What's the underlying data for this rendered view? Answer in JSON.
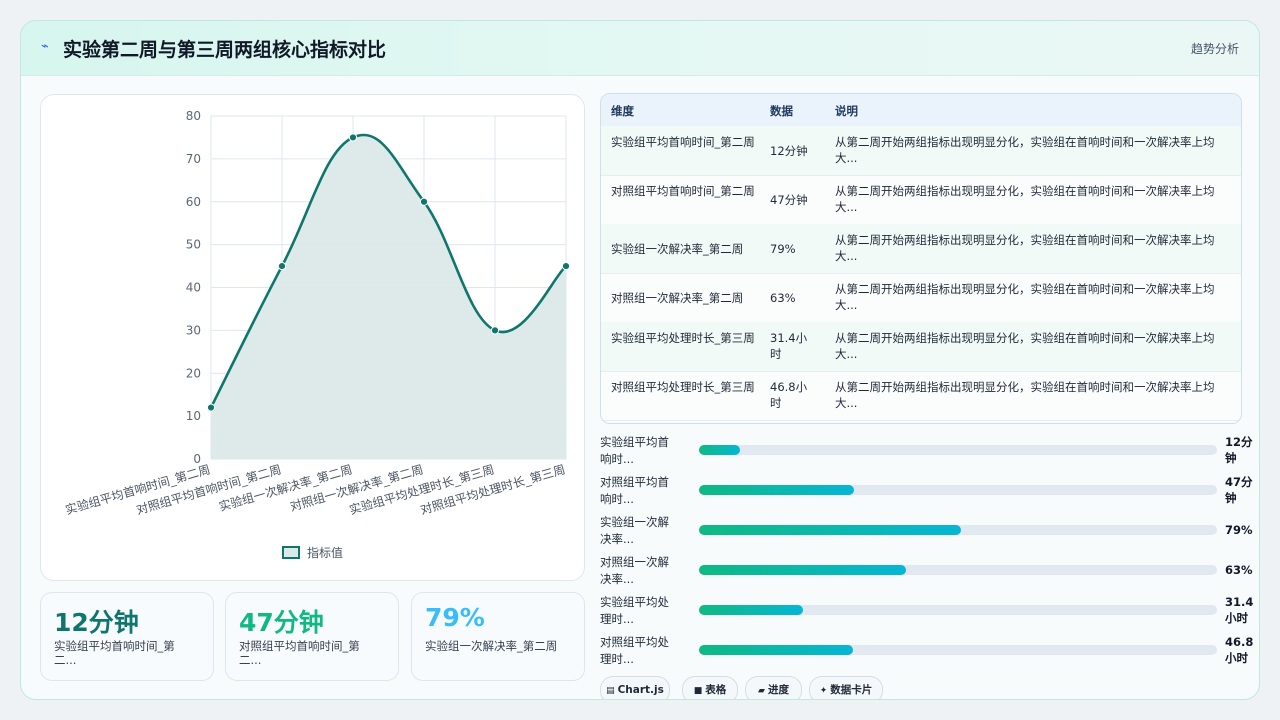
{
  "header": {
    "icon": "pulse-icon",
    "title": "实验第二周与第三周两组核心指标对比",
    "tag": "趋势分析"
  },
  "chart_data": {
    "type": "area",
    "categories": [
      "实验组平均首响时间_第二周",
      "对照组平均首响时间_第二周",
      "实验组一次解决率_第二周",
      "对照组一次解决率_第二周",
      "实验组平均处理时长_第三周",
      "对照组平均处理时长_第三周"
    ],
    "series": [
      {
        "name": "指标值",
        "values": [
          12,
          45,
          75,
          60,
          30,
          45
        ]
      }
    ],
    "ylim": [
      0,
      80
    ],
    "yticks": [
      0,
      10,
      20,
      30,
      40,
      50,
      60,
      70,
      80
    ],
    "grid": true,
    "legend": "bottom",
    "line_color": "#0f766e",
    "fill_color": "#dbe9e8"
  },
  "kpis": [
    {
      "value": "12分钟",
      "label": "实验组平均首响时间_第二...",
      "color": "#0f766e"
    },
    {
      "value": "47分钟",
      "label": "对照组平均首响时间_第二...",
      "color": "#10b981"
    },
    {
      "value": "79%",
      "label": "实验组一次解决率_第二周",
      "color": "#38bdf8"
    }
  ],
  "table": {
    "headers": [
      "维度",
      "数据",
      "说明"
    ],
    "rows": [
      {
        "dim": "实验组平均首响时间_第二周",
        "val": "12分钟",
        "desc": "从第二周开始两组指标出现明显分化，实验组在首响时间和一次解决率上均大..."
      },
      {
        "dim": "对照组平均首响时间_第二周",
        "val": "47分钟",
        "desc": "从第二周开始两组指标出现明显分化，实验组在首响时间和一次解决率上均大..."
      },
      {
        "dim": "实验组一次解决率_第二周",
        "val": "79%",
        "desc": "从第二周开始两组指标出现明显分化，实验组在首响时间和一次解决率上均大..."
      },
      {
        "dim": "对照组一次解决率_第二周",
        "val": "63%",
        "desc": "从第二周开始两组指标出现明显分化，实验组在首响时间和一次解决率上均大..."
      },
      {
        "dim": "实验组平均处理时长_第三周",
        "val": "31.4小时",
        "desc": "从第二周开始两组指标出现明显分化，实验组在首响时间和一次解决率上均大..."
      },
      {
        "dim": "对照组平均处理时长_第三周",
        "val": "46.8小时",
        "desc": "从第二周开始两组指标出现明显分化，实验组在首响时间和一次解决率上均大..."
      }
    ]
  },
  "progress": [
    {
      "label": "实验组平均首响时...",
      "value": "12分钟",
      "fraction": 0.08
    },
    {
      "label": "对照组平均首响时...",
      "value": "47分钟",
      "fraction": 0.3
    },
    {
      "label": "实验组一次解决率...",
      "value": "79%",
      "fraction": 0.505
    },
    {
      "label": "对照组一次解决率...",
      "value": "63%",
      "fraction": 0.4
    },
    {
      "label": "实验组平均处理时...",
      "value": "31.4小时",
      "fraction": 0.2
    },
    {
      "label": "对照组平均处理时...",
      "value": "46.8小时",
      "fraction": 0.297
    }
  ],
  "chips": [
    {
      "icon": "chart-icon",
      "glyph": "▤",
      "label": "Chart.js"
    },
    {
      "icon": "table-icon",
      "glyph": "■",
      "label": "表格"
    },
    {
      "icon": "progress-icon",
      "glyph": "▰",
      "label": "进度"
    },
    {
      "icon": "sparkle-icon",
      "glyph": "✦",
      "label": "数据卡片"
    }
  ]
}
